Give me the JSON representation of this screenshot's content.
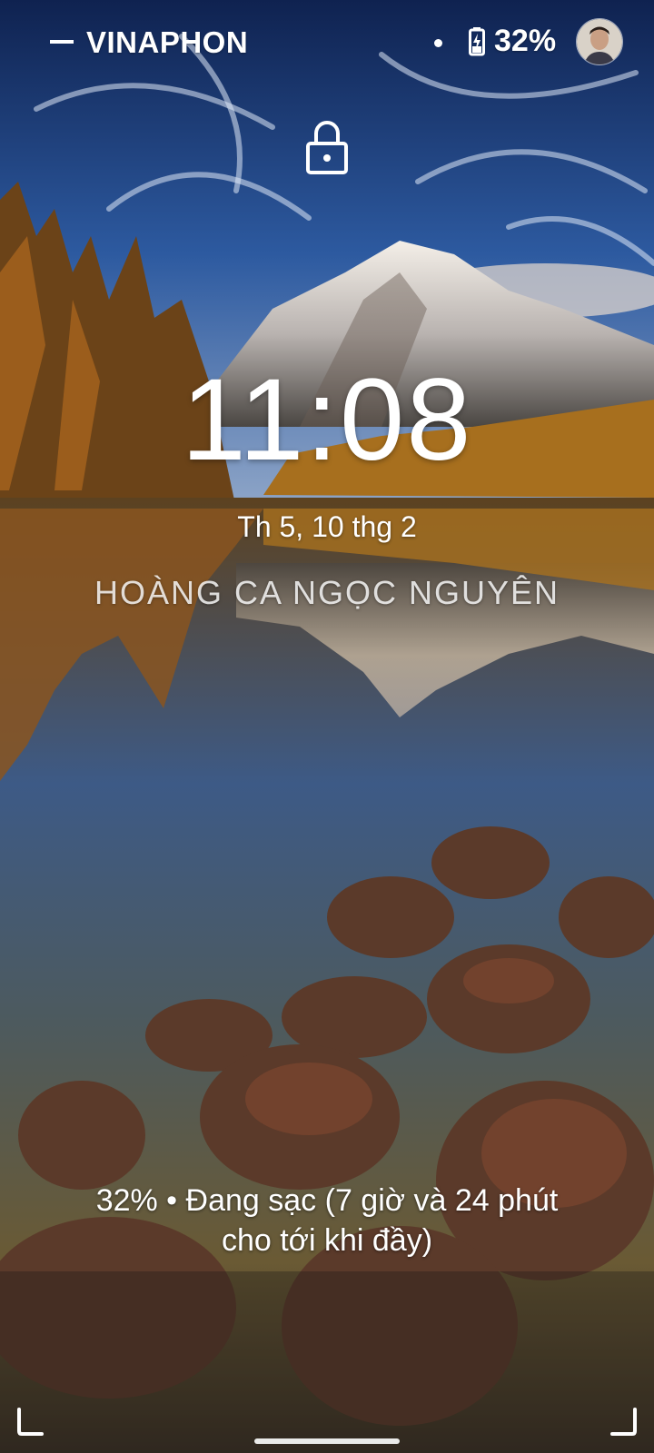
{
  "status_bar": {
    "carrier": "VINAPHON",
    "battery_percent": "32%",
    "icons": [
      "signal-dash-icon",
      "notification-dot-icon",
      "battery-charging-icon",
      "user-avatar"
    ]
  },
  "lock": {
    "icon": "lock-icon"
  },
  "clock": {
    "time": "11:08"
  },
  "date": "Th 5, 10 thg 2",
  "owner_info": "HOÀNG CA NGỌC NGUYÊN",
  "charging": {
    "line1": "32% • Đang sạc (7 giờ và 24 phút",
    "line2": "cho tới khi đầy)"
  },
  "nav": {
    "icons": [
      "corner-left-icon",
      "home-handle",
      "corner-right-icon"
    ]
  },
  "colors": {
    "text": "#ffffff",
    "sky_top": "#12264f",
    "lake": "#4a3a24"
  }
}
